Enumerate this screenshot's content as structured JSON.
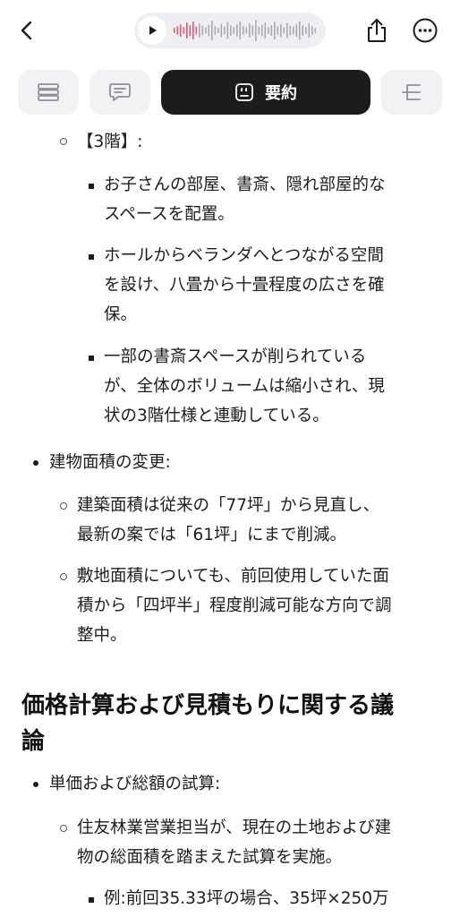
{
  "header": {
    "back_icon": "chevron-left-icon",
    "player_icon": "play-icon",
    "share_icon": "share-icon",
    "more_icon": "ellipsis-circle-icon",
    "waveform_played_color": "#e4576e",
    "waveform_unplayed_color": "#a9a9b2"
  },
  "tabs": [
    {
      "icon": "list-icon",
      "label": ""
    },
    {
      "icon": "chat-icon",
      "label": ""
    },
    {
      "icon": "summary-icon",
      "label": "要約"
    },
    {
      "icon": "mindmap-icon",
      "label": ""
    }
  ],
  "content": {
    "floor3_label": "【3階】:",
    "floor3_items": [
      [
        "お子さんの部屋、書斎、隠れ部屋的な",
        "スペースを配置。"
      ],
      [
        "ホールからベランダへとつながる空間",
        "を設け、八畳から十畳程度の広さを確",
        "保。"
      ],
      [
        "一部の書斎スペースが削られている",
        "が、全体のボリュームは縮小され、現",
        "状の3階仕様と連動している。"
      ]
    ],
    "area_change_label": "建物面積の変更:",
    "area_change_items": [
      [
        "建築面積は従来の「77坪」から見直し、",
        "最新の案では「61坪」にまで削減。"
      ],
      [
        "敷地面積についても、前回使用していた面",
        "積から「四坪半」程度削減可能な方向で調",
        "整中。"
      ]
    ],
    "price_heading": [
      "価格計算および見積もりに関する議",
      "論"
    ],
    "price_label": "単価および総額の試算:",
    "price_items": [
      [
        "住友林業営業担当が、現在の土地および建",
        "物の総面積を踏まえた試算を実施。"
      ]
    ],
    "example_line": "例:前回35.33坪の場合、35坪×250万"
  }
}
